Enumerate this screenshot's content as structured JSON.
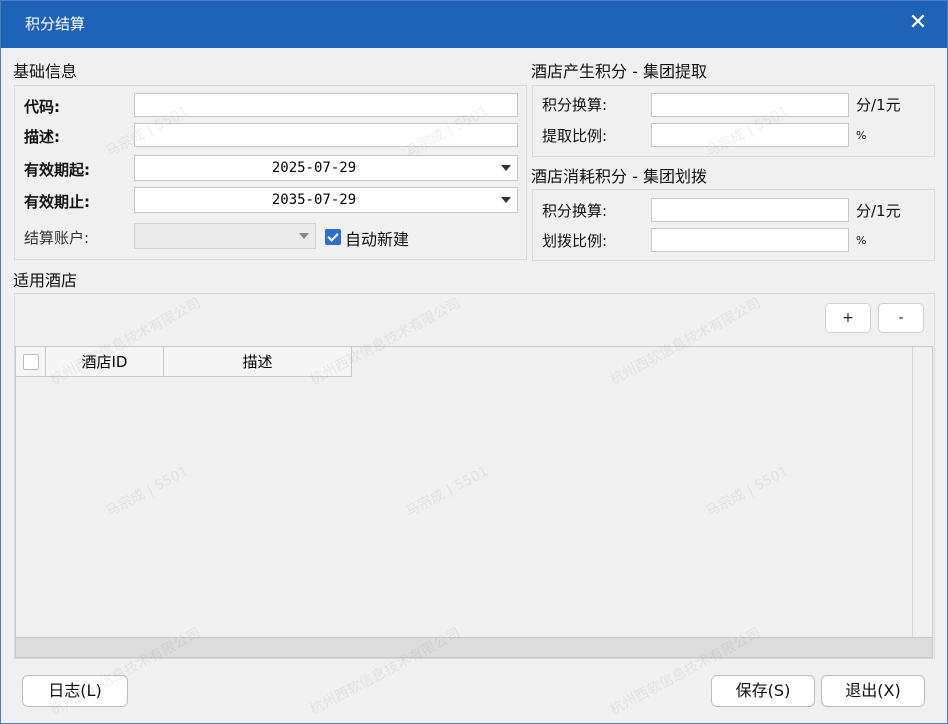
{
  "window": {
    "title": "积分结算",
    "close_glyph": "✕"
  },
  "basic": {
    "section_title": "基础信息",
    "code_label": "代码:",
    "code_value": "",
    "desc_label": "描述:",
    "desc_value": "",
    "valid_from_label": "有效期起:",
    "valid_from_value": "2025-07-29",
    "valid_to_label": "有效期止:",
    "valid_to_value": "2035-07-29",
    "account_label": "结算账户:",
    "account_value": "",
    "auto_create_label": "自动新建",
    "auto_create_checked": true
  },
  "earn": {
    "section_title": "酒店产生积分 - 集团提取",
    "rate_label": "积分换算:",
    "rate_value": "",
    "rate_unit": "分/1元",
    "ratio_label": "提取比例:",
    "ratio_value": "",
    "ratio_unit": "%"
  },
  "consume": {
    "section_title": "酒店消耗积分 - 集团划拨",
    "rate_label": "积分换算:",
    "rate_value": "",
    "rate_unit": "分/1元",
    "ratio_label": "划拨比例:",
    "ratio_value": "",
    "ratio_unit": "%"
  },
  "hotels": {
    "section_title": "适用酒店",
    "add_label": "+",
    "remove_label": "-",
    "columns": [
      "",
      "酒店ID",
      "描述"
    ],
    "rows": []
  },
  "footer": {
    "log_label": "日志(L)",
    "save_label": "保存(S)",
    "exit_label": "退出(X)"
  },
  "watermark": {
    "text_company": "杭州西软信息技术有限公司",
    "text_user": "马宗成 | 5501"
  }
}
